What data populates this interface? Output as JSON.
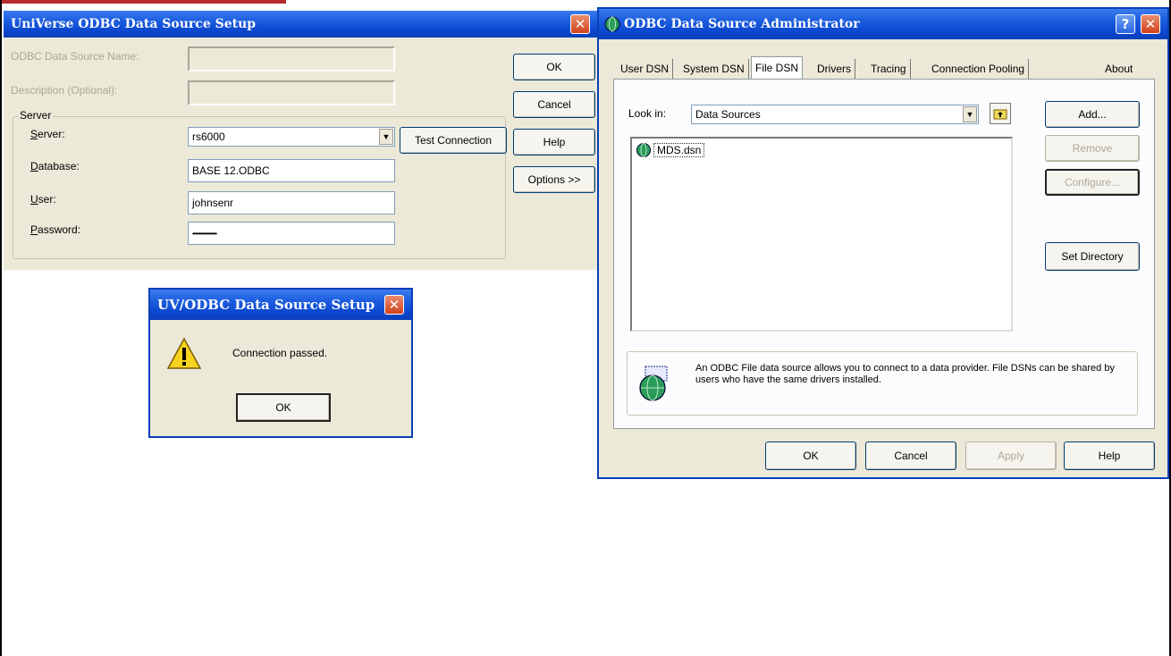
{
  "universe_dialog": {
    "title": "UniVerse ODBC Data Source Setup",
    "dsn_label": "ODBC Data Source Name:",
    "desc_label": "Description (Optional):",
    "group_label": "Server",
    "server_label": "Server:",
    "server_value": "rs6000",
    "database_label": "Database:",
    "database_value": "BASE 12.ODBC",
    "user_label": "User:",
    "user_value": "johnsenr",
    "password_label": "Password:",
    "password_value": "•••••••••••••••",
    "test_connection": "Test Connection",
    "ok": "OK",
    "cancel": "Cancel",
    "help": "Help",
    "options": "Options >>"
  },
  "message_box": {
    "title": "UV/ODBC Data Source Setup",
    "message": "Connection passed.",
    "ok": "OK"
  },
  "admin_dialog": {
    "title": "ODBC Data Source Administrator",
    "tabs": [
      "User DSN",
      "System DSN",
      "File DSN",
      "Drivers",
      "Tracing",
      "Connection Pooling",
      "About"
    ],
    "active_tab": "File DSN",
    "look_in_label": "Look in:",
    "look_in_value": "Data Sources",
    "files": [
      "MDS.dsn"
    ],
    "add": "Add...",
    "remove": "Remove",
    "configure": "Configure...",
    "set_directory": "Set Directory",
    "info_text": "An ODBC File data source allows you to connect to a data provider.  File DSNs can be shared by users who have the same drivers installed.",
    "ok": "OK",
    "cancel": "Cancel",
    "apply": "Apply",
    "help": "Help"
  },
  "colors": {
    "titlebar": "#0b47cf",
    "dialog_bg": "#ece9d8",
    "close_button": "#d2431c"
  }
}
